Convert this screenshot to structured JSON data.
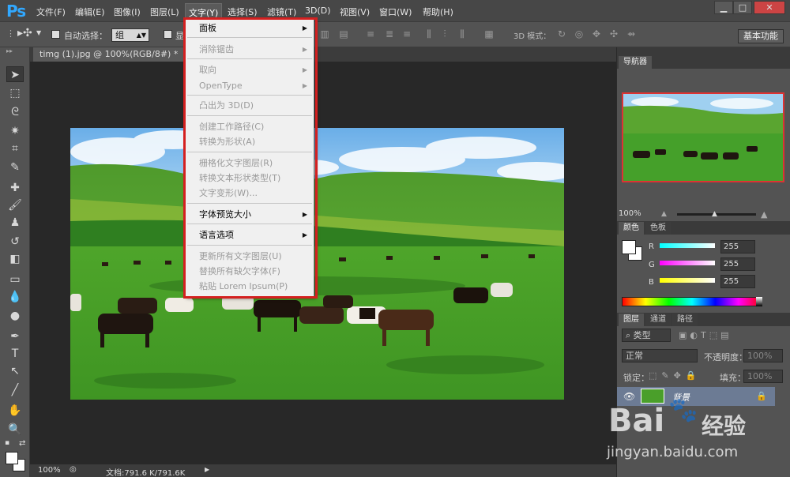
{
  "app": {
    "logo": "Ps"
  },
  "menubar": {
    "items": [
      {
        "label": "文件(F)"
      },
      {
        "label": "编辑(E)"
      },
      {
        "label": "图像(I)"
      },
      {
        "label": "图层(L)"
      },
      {
        "label": "文字(Y)"
      },
      {
        "label": "选择(S)"
      },
      {
        "label": "滤镜(T)"
      },
      {
        "label": "3D(D)"
      },
      {
        "label": "视图(V)"
      },
      {
        "label": "窗口(W)"
      },
      {
        "label": "帮助(H)"
      }
    ],
    "window_buttons": {
      "minimize": "▁",
      "maximize": "□",
      "close": "✕"
    }
  },
  "options": {
    "auto_select_label": "自动选择：",
    "auto_select_value": "组",
    "show_transform_label": "显",
    "mode_3d_label": "3D 模式：",
    "workspace_label": "基本功能"
  },
  "document": {
    "tab_label": "timg (1).jpg @ 100%(RGB/8#) *",
    "tab_close": "×",
    "status_zoom": "100%",
    "status_doc": "文档:791.6 K/791.6K"
  },
  "type_menu": {
    "items": [
      {
        "label": "面板",
        "enabled": true,
        "submenu": true
      },
      {
        "label": "消除锯齿",
        "enabled": false,
        "submenu": true
      },
      {
        "label": "取向",
        "enabled": false,
        "submenu": true
      },
      {
        "label": "OpenType",
        "enabled": false,
        "submenu": true
      },
      {
        "label": "凸出为 3D(D)",
        "enabled": false,
        "submenu": false
      },
      {
        "label": "创建工作路径(C)",
        "enabled": false,
        "submenu": false
      },
      {
        "label": "转换为形状(A)",
        "enabled": false,
        "submenu": false
      },
      {
        "label": "栅格化文字图层(R)",
        "enabled": false,
        "submenu": false
      },
      {
        "label": "转换文本形状类型(T)",
        "enabled": false,
        "submenu": false
      },
      {
        "label": "文字变形(W)...",
        "enabled": false,
        "submenu": false
      },
      {
        "label": "字体预览大小",
        "enabled": true,
        "submenu": true
      },
      {
        "label": "语言选项",
        "enabled": true,
        "submenu": true
      },
      {
        "label": "更新所有文字图层(U)",
        "enabled": false,
        "submenu": false
      },
      {
        "label": "替换所有缺欠字体(F)",
        "enabled": false,
        "submenu": false
      },
      {
        "label": "粘贴 Lorem Ipsum(P)",
        "enabled": false,
        "submenu": false
      }
    ],
    "submenu_arrow": "▶",
    "highlight_color": "#d42020"
  },
  "navigator": {
    "tab": "导航器",
    "zoom": "100%"
  },
  "color_panel": {
    "tabs": [
      "颜色",
      "色板"
    ],
    "r_label": "R",
    "g_label": "G",
    "b_label": "B",
    "r": "255",
    "g": "255",
    "b": "255"
  },
  "layers_panel": {
    "tabs": [
      "图层",
      "通道",
      "路径"
    ],
    "filter_label": "类型",
    "blend_mode": "正常",
    "opacity_label": "不透明度：",
    "opacity_value": "100%",
    "lock_label": "锁定：",
    "fill_label": "填充：",
    "fill_value": "100%",
    "layer_name": "背景"
  },
  "watermark": {
    "brand": "Bai",
    "brand_cn": "经验",
    "url": "jingyan.baidu.com"
  }
}
